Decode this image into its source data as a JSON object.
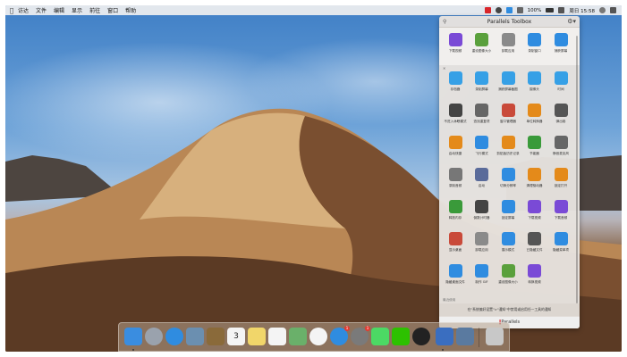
{
  "menubar": {
    "apple_glyph": "",
    "items": [
      "访达",
      "文件",
      "编辑",
      "显示",
      "前往",
      "窗口",
      "帮助"
    ],
    "battery": "100%",
    "clock": "周日 15:58"
  },
  "toolbox": {
    "title": "Parallels Toolbox",
    "pinned": [
      {
        "label": "下载视频",
        "icon": "download-video-icon",
        "color": "#7a4ad6"
      },
      {
        "label": "重设图像大小",
        "icon": "resize-image-icon",
        "color": "#5aa03c"
      },
      {
        "label": "卸载应用",
        "icon": "uninstall-app-icon",
        "color": "#8a8a8a"
      },
      {
        "label": "录制窗口",
        "icon": "record-window-icon",
        "color": "#2f8ce0"
      },
      {
        "label": "捕获屏幕",
        "icon": "capture-screen-icon",
        "color": "#2f8ce0"
      }
    ],
    "tools": [
      {
        "label": "存档器",
        "icon": "archive-icon",
        "color": "#36a0e6"
      },
      {
        "label": "录制屏幕",
        "icon": "record-screen-icon",
        "color": "#36a0e6"
      },
      {
        "label": "捕获屏幕截图",
        "icon": "screenshot-icon",
        "color": "#36a0e6"
      },
      {
        "label": "摄像头",
        "icon": "webcam-icon",
        "color": "#36a0e6"
      },
      {
        "label": "时间",
        "icon": "clock-icon",
        "color": "#36a0e6"
      },
      {
        "label": "不进入休眠模式",
        "icon": "no-sleep-icon",
        "color": "#444444"
      },
      {
        "label": "查找重复项",
        "icon": "find-duplicates-icon",
        "color": "#666666"
      },
      {
        "label": "窗口管理器",
        "icon": "window-manager-icon",
        "color": "#c94a3a"
      },
      {
        "label": "单位转换器",
        "icon": "unit-converter-icon",
        "color": "#e48a1a"
      },
      {
        "label": "弹出卷",
        "icon": "eject-icon",
        "color": "#555555"
      },
      {
        "label": "启动快捷",
        "icon": "launch-icon",
        "color": "#e48a1a"
      },
      {
        "label": "飞行模式",
        "icon": "airplane-icon",
        "color": "#2f8ce0"
      },
      {
        "label": "剪贴板历史记录",
        "icon": "clipboard-icon",
        "color": "#e48a1a"
      },
      {
        "label": "节能器",
        "icon": "energy-saver-icon",
        "color": "#3a9a3a"
      },
      {
        "label": "静音麦克风",
        "icon": "mute-mic-icon",
        "color": "#666666"
      },
      {
        "label": "录制音频",
        "icon": "record-audio-icon",
        "color": "#777777"
      },
      {
        "label": "启动",
        "icon": "launch-app-icon",
        "color": "#5a6b9a"
      },
      {
        "label": "切换分辨率",
        "icon": "switch-resolution-icon",
        "color": "#2f8ce0"
      },
      {
        "label": "清理驱动器",
        "icon": "clean-drive-icon",
        "color": "#e48a1a"
      },
      {
        "label": "锁定打开",
        "icon": "lock-icon",
        "color": "#e48a1a"
      },
      {
        "label": "释放内存",
        "icon": "free-memory-icon",
        "color": "#3a9a3a"
      },
      {
        "label": "倒数计时器",
        "icon": "countdown-icon",
        "color": "#444444"
      },
      {
        "label": "锁定屏幕",
        "icon": "lock-screen-icon",
        "color": "#2f8ce0"
      },
      {
        "label": "下载视频",
        "icon": "download-video-icon",
        "color": "#7a4ad6"
      },
      {
        "label": "下载音频",
        "icon": "download-audio-icon",
        "color": "#7a4ad6"
      },
      {
        "label": "显示桌面",
        "icon": "show-desktop-icon",
        "color": "#c94a3a"
      },
      {
        "label": "卸载应用",
        "icon": "uninstall-app-icon",
        "color": "#8a8a8a"
      },
      {
        "label": "展示模式",
        "icon": "presentation-icon",
        "color": "#2f8ce0"
      },
      {
        "label": "已隐藏文件",
        "icon": "hidden-files-icon",
        "color": "#555555"
      },
      {
        "label": "隐藏菜单项",
        "icon": "hide-menu-icon",
        "color": "#2f8ce0"
      },
      {
        "label": "隐藏桌面文件",
        "icon": "hide-desktop-files-icon",
        "color": "#2f8ce0"
      },
      {
        "label": "制作 GIF",
        "icon": "make-gif-icon",
        "color": "#2f8ce0"
      },
      {
        "label": "重设图像大小",
        "icon": "resize-image-icon",
        "color": "#5aa03c"
      },
      {
        "label": "转换视频",
        "icon": "convert-video-icon",
        "color": "#7a4ad6"
      }
    ],
    "footer_section": "最近使用",
    "footer_message": "在\"系统偏好设置\">\"通知\"中禁用或启用任一工具的通知",
    "brand_bars": "‖",
    "brand_name": "Parallels"
  },
  "dock": {
    "apps": [
      {
        "name": "finder-icon",
        "color": "#3a8de0"
      },
      {
        "name": "launchpad-icon",
        "color": "#9aa2ad"
      },
      {
        "name": "safari-icon",
        "color": "#2f8ce0"
      },
      {
        "name": "preview-icon",
        "color": "#6b8fb0"
      },
      {
        "name": "notes-book-icon",
        "color": "#8a6a3a"
      },
      {
        "name": "calendar-icon",
        "color": "#f4f4f4"
      },
      {
        "name": "notes-icon",
        "color": "#f1d66a"
      },
      {
        "name": "reminders-icon",
        "color": "#f4f4f4"
      },
      {
        "name": "maps-icon",
        "color": "#6ab06a"
      },
      {
        "name": "photos-icon",
        "color": "#f4f4f4"
      },
      {
        "name": "app-store-icon",
        "color": "#2f8ce0"
      },
      {
        "name": "system-preferences-icon",
        "color": "#7a7a7a"
      },
      {
        "name": "messages-icon",
        "color": "#4cd964"
      },
      {
        "name": "wechat-icon",
        "color": "#2dc100"
      },
      {
        "name": "qq-icon",
        "color": "#222222"
      },
      {
        "name": "parallels-icon",
        "color": "#3a6ec0"
      },
      {
        "name": "screen-icon",
        "color": "#5a7aa0"
      },
      {
        "name": "trash-icon",
        "color": "#c8c8c8"
      }
    ],
    "calendar_day": "3",
    "app_store_badge": "1",
    "sysprefs_badge": "1"
  }
}
